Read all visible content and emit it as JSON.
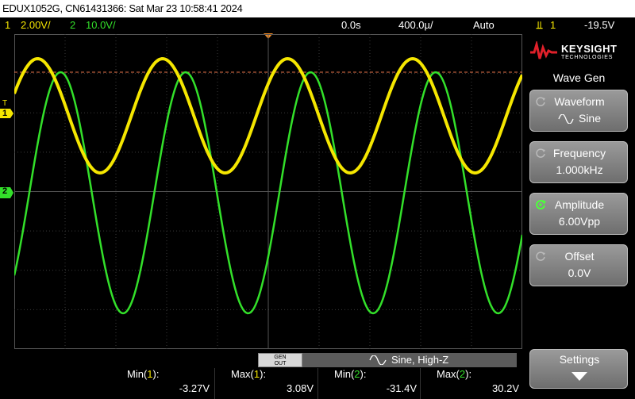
{
  "title": "EDUX1052G, CN61431366: Sat Mar 23 10:58:41 2024",
  "status": {
    "ch1_num": "1",
    "ch1_scale": "2.00V/",
    "ch2_num": "2",
    "ch2_scale": "10.0V/",
    "time_offset": "0.0s",
    "timebase": "400.0µ/",
    "trigger_mode": "Auto",
    "trigger_source": "1",
    "trigger_level": "-19.5V"
  },
  "markers": {
    "ch1": "1",
    "ch1_trig": "T",
    "ch2": "2"
  },
  "waveform": {
    "ch1_color": "#f5e600",
    "ch2_color": "#33e02a",
    "grid_color": "#3a3a3a",
    "trigger_line_color": "#e8744a"
  },
  "side_panel": {
    "brand": "KEYSIGHT",
    "brand_sub": "TECHNOLOGIES",
    "title": "Wave Gen",
    "softkeys": [
      {
        "label": "Waveform",
        "value": "Sine"
      },
      {
        "label": "Frequency",
        "value": "1.000kHz"
      },
      {
        "label": "Amplitude",
        "value": "6.00Vpp"
      },
      {
        "label": "Offset",
        "value": "0.0V"
      }
    ],
    "settings_label": "Settings"
  },
  "gen_bar": {
    "button_line1": "GEN",
    "button_line2": "OUT",
    "text": "Sine, High-Z"
  },
  "measurements": [
    {
      "label_pre": "Min(",
      "ch": "1",
      "label_post": "):",
      "value": "-3.27V",
      "color": "#f5e600"
    },
    {
      "label_pre": "Max(",
      "ch": "1",
      "label_post": "):",
      "value": "3.08V",
      "color": "#f5e600"
    },
    {
      "label_pre": "Min(",
      "ch": "2",
      "label_post": "):",
      "value": "-31.4V",
      "color": "#33e02a"
    },
    {
      "label_pre": "Max(",
      "ch": "2",
      "label_post": "):",
      "value": "30.2V",
      "color": "#33e02a"
    }
  ]
}
